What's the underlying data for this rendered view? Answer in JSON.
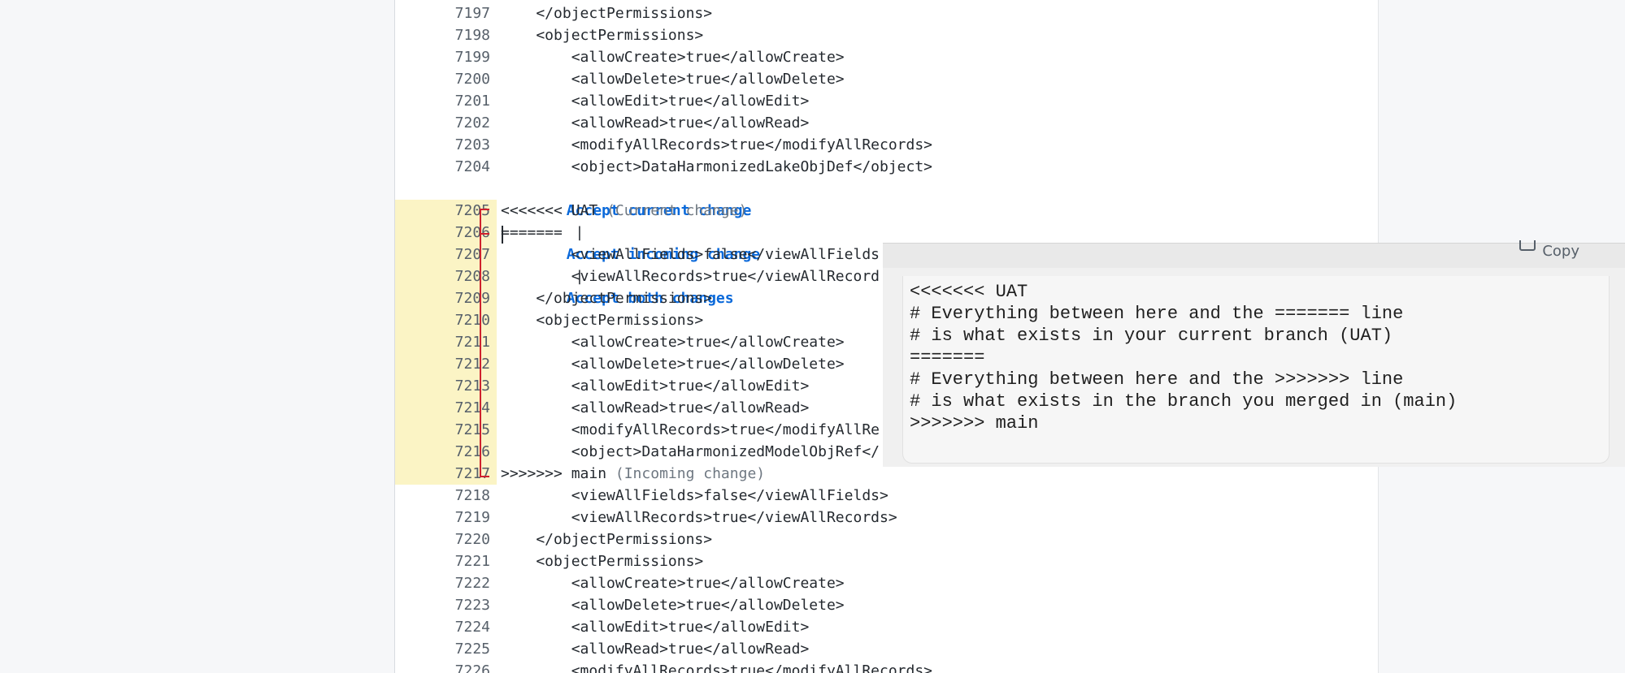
{
  "editor": {
    "codelens": {
      "accept_current": "Accept current change",
      "accept_incoming": "Accept incoming change",
      "accept_both": "Accept both changes",
      "separator": "|"
    },
    "lines_before": [
      {
        "num": "7197",
        "text": "    </objectPermissions>"
      },
      {
        "num": "7198",
        "text": "    <objectPermissions>"
      },
      {
        "num": "7199",
        "text": "        <allowCreate>true</allowCreate>"
      },
      {
        "num": "7200",
        "text": "        <allowDelete>true</allowDelete>"
      },
      {
        "num": "7201",
        "text": "        <allowEdit>true</allowEdit>"
      },
      {
        "num": "7202",
        "text": "        <allowRead>true</allowRead>"
      },
      {
        "num": "7203",
        "text": "        <modifyAllRecords>true</modifyAllRecords>"
      },
      {
        "num": "7204",
        "text": "        <object>DataHarmonizedLakeObjDef</object>"
      }
    ],
    "conflict_lines": [
      {
        "num": "7205",
        "text": "<<<<<<< UAT",
        "hint": " (Current change)"
      },
      {
        "num": "7206",
        "text": "=======",
        "hint": ""
      },
      {
        "num": "7207",
        "text": "        <viewAllFields>false</viewAllFields",
        "hint": ""
      },
      {
        "num": "7208",
        "text": "        <viewAllRecords>true</viewAllRecord",
        "hint": ""
      },
      {
        "num": "7209",
        "text": "    </objectPermissions>",
        "hint": ""
      },
      {
        "num": "7210",
        "text": "    <objectPermissions>",
        "hint": ""
      },
      {
        "num": "7211",
        "text": "        <allowCreate>true</allowCreate>",
        "hint": ""
      },
      {
        "num": "7212",
        "text": "        <allowDelete>true</allowDelete>",
        "hint": ""
      },
      {
        "num": "7213",
        "text": "        <allowEdit>true</allowEdit>",
        "hint": ""
      },
      {
        "num": "7214",
        "text": "        <allowRead>true</allowRead>",
        "hint": ""
      },
      {
        "num": "7215",
        "text": "        <modifyAllRecords>true</modifyAllRe",
        "hint": ""
      },
      {
        "num": "7216",
        "text": "        <object>DataHarmonizedModelObjRef</",
        "hint": ""
      },
      {
        "num": "7217",
        "text": ">>>>>>> main",
        "hint": " (Incoming change)"
      }
    ],
    "lines_after": [
      {
        "num": "7218",
        "text": "        <viewAllFields>false</viewAllFields>"
      },
      {
        "num": "7219",
        "text": "        <viewAllRecords>true</viewAllRecords>"
      },
      {
        "num": "7220",
        "text": "    </objectPermissions>"
      },
      {
        "num": "7221",
        "text": "    <objectPermissions>"
      },
      {
        "num": "7222",
        "text": "        <allowCreate>true</allowCreate>"
      },
      {
        "num": "7223",
        "text": "        <allowDelete>true</allowDelete>"
      },
      {
        "num": "7224",
        "text": "        <allowEdit>true</allowEdit>"
      },
      {
        "num": "7225",
        "text": "        <allowRead>true</allowRead>"
      },
      {
        "num": "7226",
        "text": "        <modifyAllRecords>true</modifyAllRecords>"
      }
    ]
  },
  "tooltip": {
    "copy_label": "Copy",
    "copy_icon": "copy-icon",
    "snippet": [
      "<<<<<<< UAT",
      "# Everything between here and the ======= line",
      "# is what exists in your current branch (UAT)",
      "=======",
      "# Everything between here and the >>>>>>> line",
      "# is what exists in the branch you merged in (main)",
      ">>>>>>> main"
    ]
  },
  "colors": {
    "conflict_gutter": "#fbf4c5",
    "conflict_bracket": "#cf222e",
    "codelens_link": "#0a69da"
  }
}
